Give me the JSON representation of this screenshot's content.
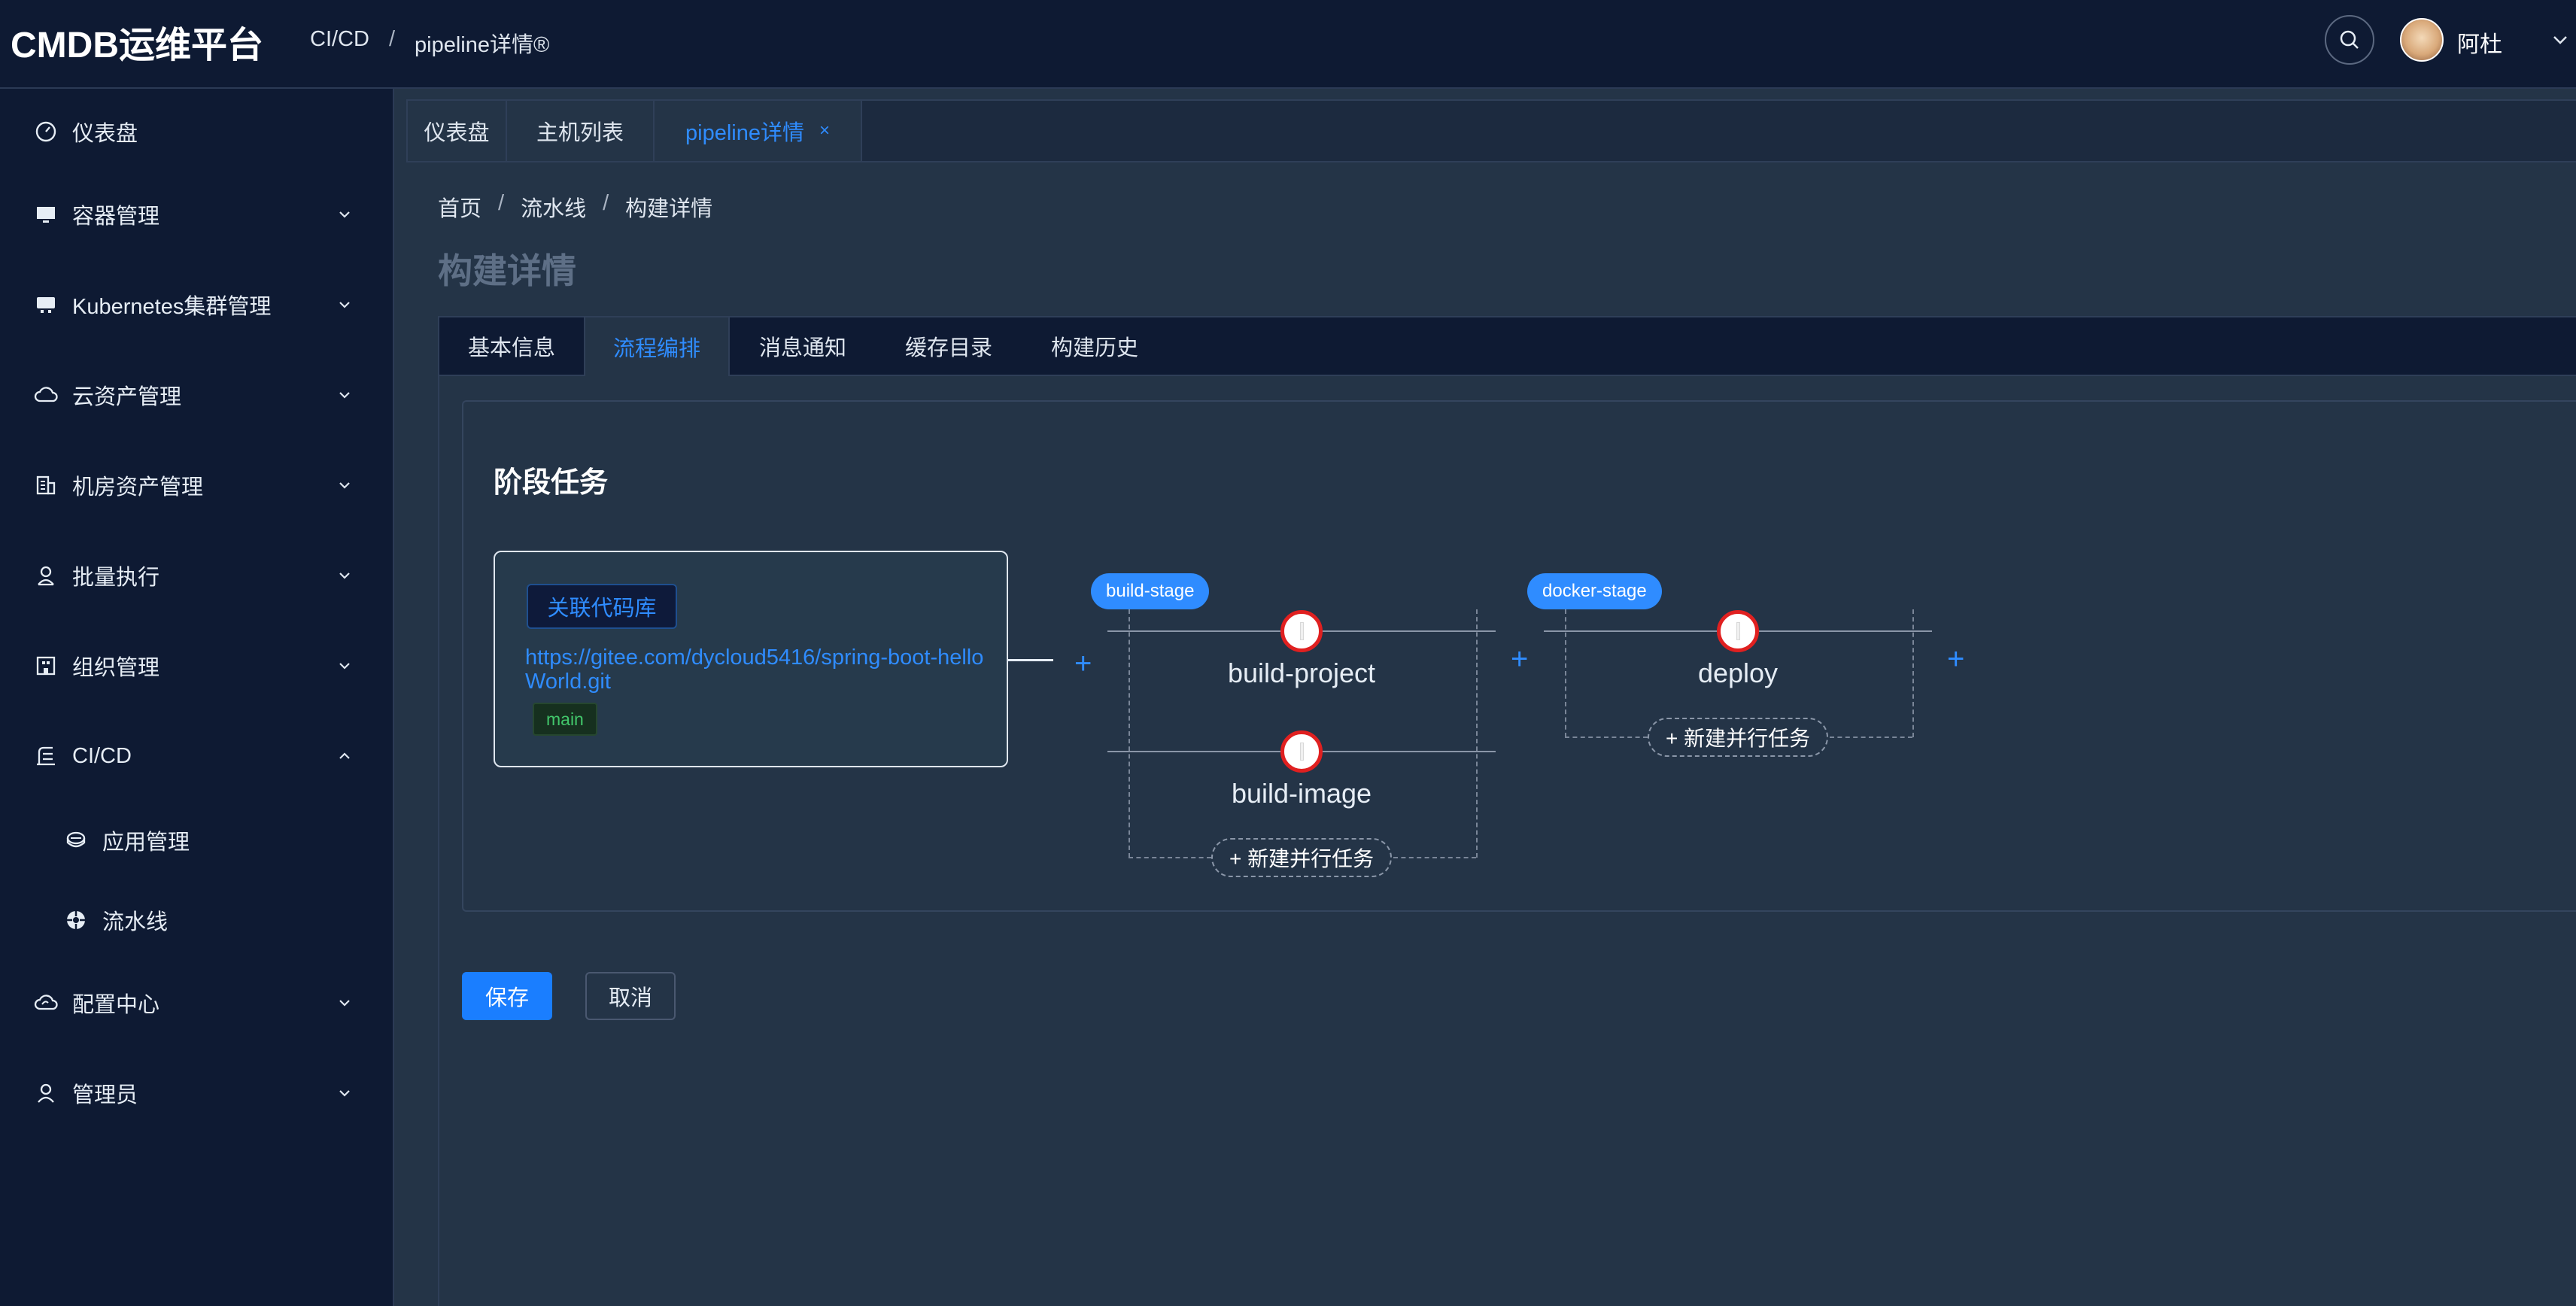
{
  "app": {
    "title": "CMDB运维平台"
  },
  "header": {
    "breadcrumb": [
      "CI/CD",
      "pipeline详情®"
    ],
    "user_name": "阿杜"
  },
  "sidebar": {
    "items": [
      {
        "label": "仪表盘",
        "icon": "dashboard-icon"
      },
      {
        "label": "容器管理",
        "icon": "monitor-icon"
      },
      {
        "label": "Kubernetes集群管理",
        "icon": "cluster-icon"
      },
      {
        "label": "云资产管理",
        "icon": "cloud-icon"
      },
      {
        "label": "机房资产管理",
        "icon": "building-icon"
      },
      {
        "label": "批量执行",
        "icon": "user-icon"
      },
      {
        "label": "组织管理",
        "icon": "org-icon"
      },
      {
        "label": "CI/CD",
        "icon": "cicd-icon",
        "expanded": true,
        "children": [
          {
            "label": "应用管理",
            "icon": "app-icon"
          },
          {
            "label": "流水线",
            "icon": "pipeline-icon"
          }
        ]
      },
      {
        "label": "配置中心",
        "icon": "config-icon"
      },
      {
        "label": "管理员",
        "icon": "admin-icon"
      }
    ]
  },
  "tabs": [
    {
      "label": "仪表盘"
    },
    {
      "label": "主机列表"
    },
    {
      "label": "pipeline详情",
      "active": true,
      "close": "×"
    }
  ],
  "breadcrumb": [
    "首页",
    "流水线",
    "构建详情"
  ],
  "page_title": "构建详情",
  "inner_tabs": [
    "基本信息",
    "流程编排",
    "消息通知",
    "缓存目录",
    "构建历史"
  ],
  "active_inner_tab": "流程编排",
  "section_title": "阶段任务",
  "repo": {
    "button": "关联代码库",
    "url": "https://gitee.com/dycloud5416/spring-boot-helloWorld.git",
    "branch": "main"
  },
  "stages": [
    {
      "name": "build-stage",
      "tasks": [
        "build-project",
        "build-image"
      ],
      "add_label": "+ 新建并行任务"
    },
    {
      "name": "docker-stage",
      "tasks": [
        "deploy"
      ],
      "add_label": "+ 新建并行任务"
    }
  ],
  "plus_symbol": "+",
  "actions": {
    "save": "保存",
    "cancel": "取消"
  },
  "colors": {
    "accent": "#2f8cff",
    "header_bg": "#0e1a33",
    "content_bg": "#243447",
    "task_ring": "#e02020",
    "branch": "#42c76b"
  }
}
